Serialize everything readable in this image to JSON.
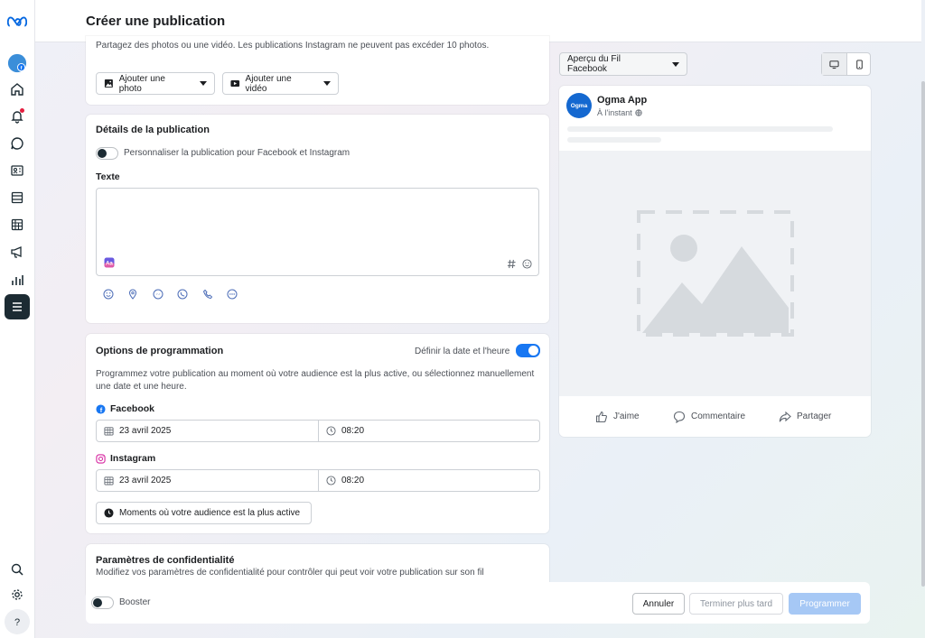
{
  "header": {
    "title": "Créer une publication"
  },
  "media": {
    "description": "Partagez des photos ou une vidéo. Les publications Instagram ne peuvent pas excéder 10 photos.",
    "add_photo": "Ajouter une photo",
    "add_video": "Ajouter une vidéo"
  },
  "details": {
    "title": "Détails de la publication",
    "customize_label": "Personnaliser la publication pour Facebook et Instagram",
    "text_label": "Texte",
    "text_value": ""
  },
  "schedule": {
    "title": "Options de programmation",
    "toggle_label": "Définir la date et l'heure",
    "description": "Programmez votre publication au moment où votre audience est la plus active, ou sélectionnez manuellement une date et une heure.",
    "facebook": {
      "label": "Facebook",
      "date": "23 avril 2025",
      "time": "08:20"
    },
    "instagram": {
      "label": "Instagram",
      "date": "23 avril 2025",
      "time": "08:20"
    },
    "best_time_button": "Moments où votre audience est la plus active"
  },
  "privacy": {
    "title": "Paramètres de confidentialité",
    "description": "Modifiez vos paramètres de confidentialité pour contrôler qui peut voir votre publication sur son fil"
  },
  "preview": {
    "dropdown": "Aperçu du Fil Facebook",
    "page_name": "Ogma App",
    "avatar_text": "Ogma",
    "timestamp": "À l'instant",
    "like": "J'aime",
    "comment": "Commentaire",
    "share": "Partager"
  },
  "footer": {
    "boost_label": "Booster",
    "cancel": "Annuler",
    "finish_later": "Terminer plus tard",
    "schedule": "Programmer"
  },
  "colors": {
    "accent": "#1877f2",
    "rail_active": "#1c2b33",
    "disabled_button": "#a6c8f5"
  }
}
